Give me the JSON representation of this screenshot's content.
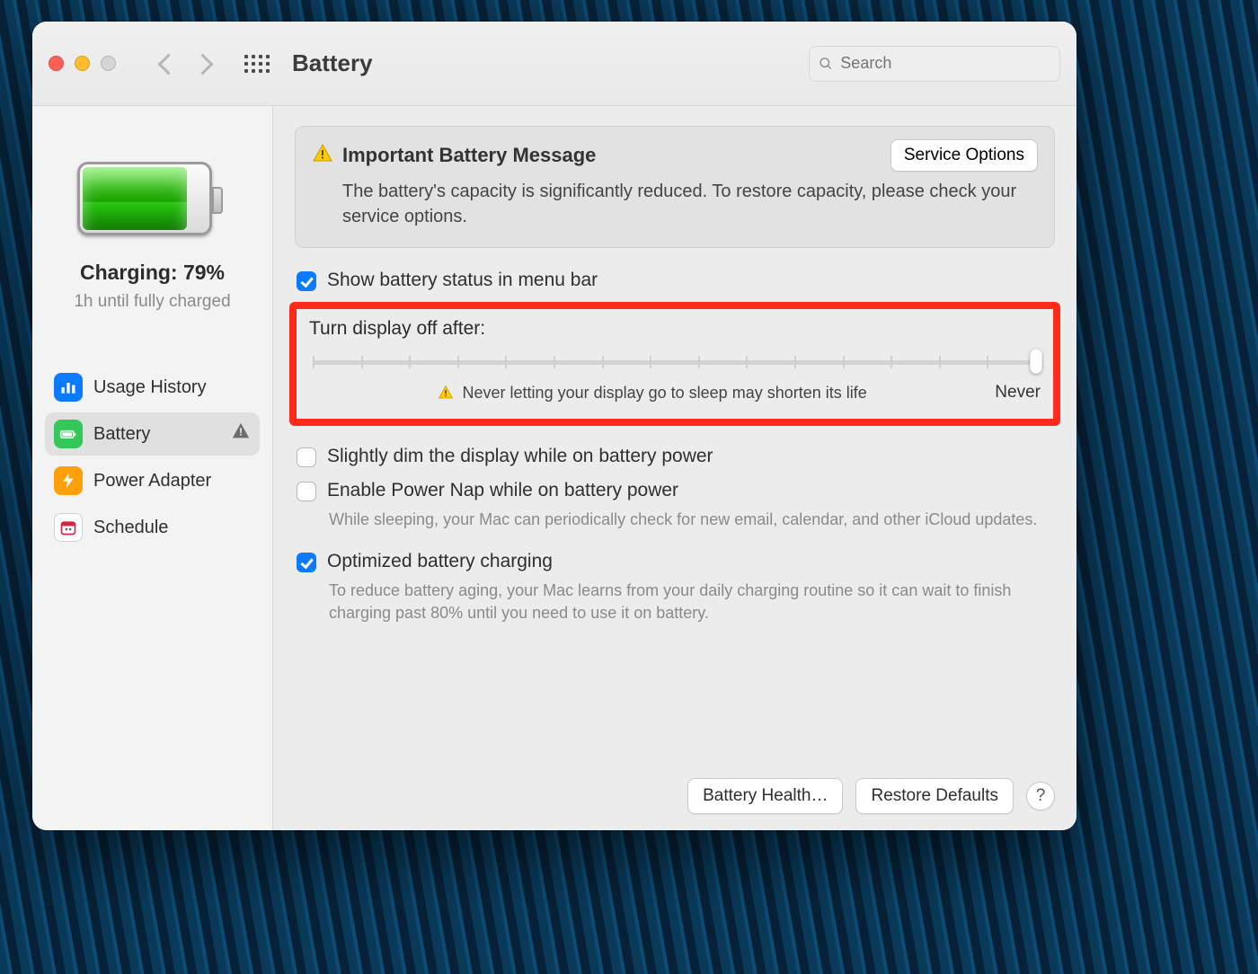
{
  "toolbar": {
    "title": "Battery",
    "search_placeholder": "Search"
  },
  "sidebar": {
    "charge_label": "Charging: 79%",
    "charge_sub": "1h until fully charged",
    "items": [
      {
        "label": "Usage History",
        "icon": "bar-chart",
        "bg": "#0a7bff"
      },
      {
        "label": "Battery",
        "icon": "battery",
        "bg": "#34c759",
        "selected": true,
        "warn": true
      },
      {
        "label": "Power Adapter",
        "icon": "bolt",
        "bg": "#ff9f0a"
      },
      {
        "label": "Schedule",
        "icon": "calendar",
        "bg": "#ffffff",
        "border": true
      }
    ]
  },
  "alert": {
    "title": "Important Battery Message",
    "button": "Service Options",
    "body": "The battery's capacity is significantly reduced. To restore capacity, please check your service options."
  },
  "options": {
    "show_menu": {
      "checked": true,
      "label": "Show battery status in menu bar"
    },
    "display_off": {
      "label": "Turn display off after:",
      "warning": "Never letting your display go to sleep may shorten its life",
      "value": "Never"
    },
    "dim": {
      "checked": false,
      "label": "Slightly dim the display while on battery power"
    },
    "powernap": {
      "checked": false,
      "label": "Enable Power Nap while on battery power",
      "desc": "While sleeping, your Mac can periodically check for new email, calendar, and other iCloud updates."
    },
    "optimized": {
      "checked": true,
      "label": "Optimized battery charging",
      "desc": "To reduce battery aging, your Mac learns from your daily charging routine so it can wait to finish charging past 80% until you need to use it on battery."
    }
  },
  "footer": {
    "health": "Battery Health…",
    "restore": "Restore Defaults",
    "help": "?"
  }
}
